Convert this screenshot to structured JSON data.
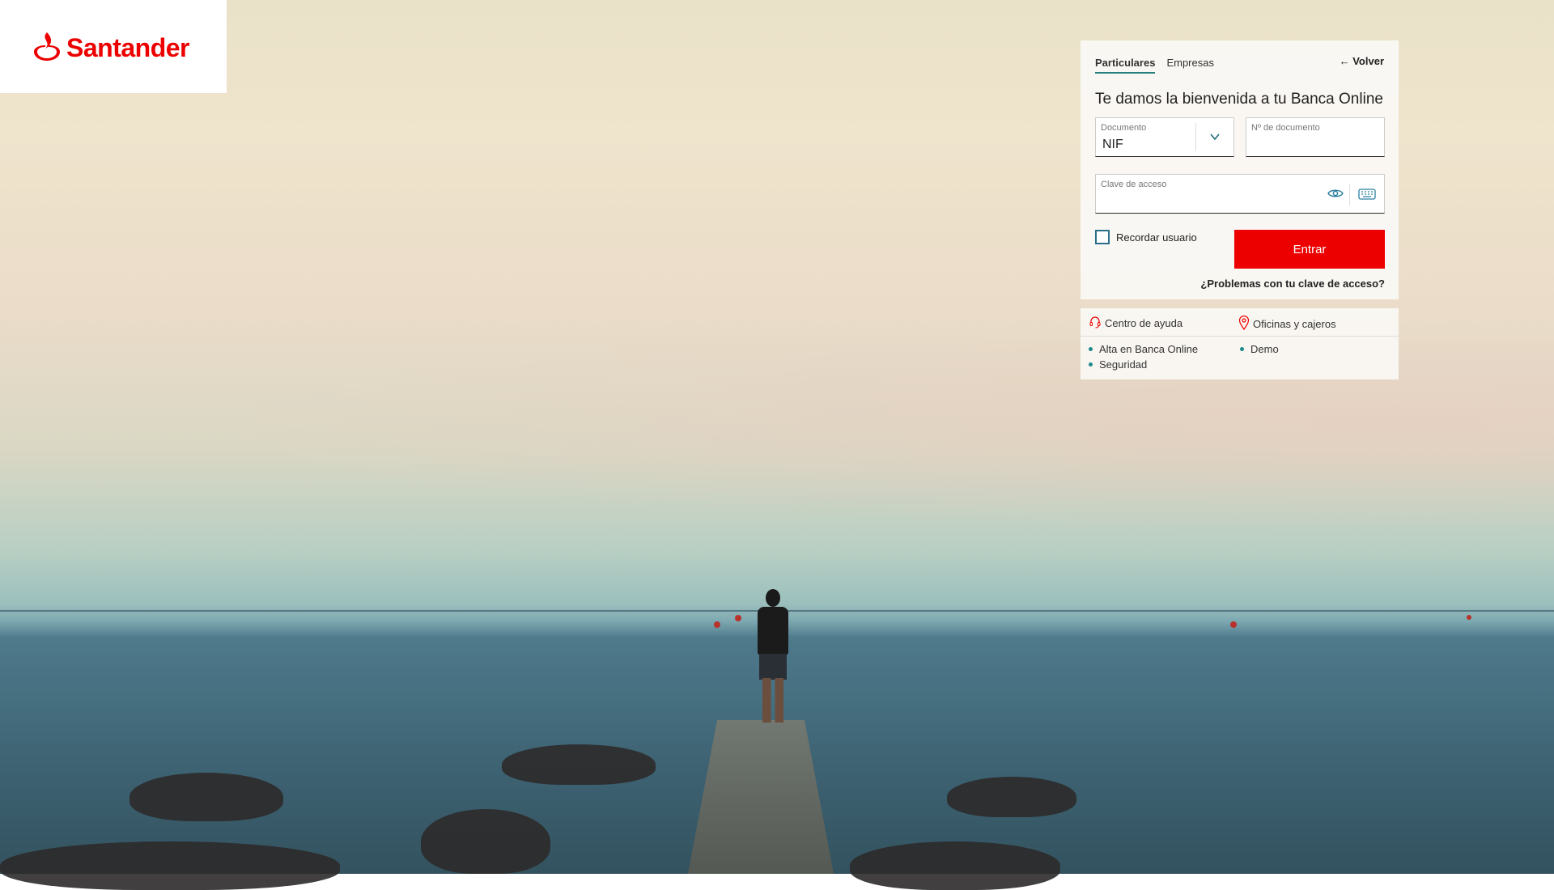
{
  "brand": {
    "name": "Santander",
    "color": "#ec0000"
  },
  "tabs": [
    {
      "label": "Particulares",
      "active": true
    },
    {
      "label": "Empresas",
      "active": false
    }
  ],
  "back_label": "Volver",
  "welcome": "Te damos la bienvenida a tu Banca Online",
  "document": {
    "label": "Documento",
    "value": "NIF"
  },
  "doc_number": {
    "label": "Nº de documento",
    "value": ""
  },
  "password": {
    "label": "Clave de acceso",
    "value": ""
  },
  "remember_label": "Recordar usuario",
  "enter_label": "Entrar",
  "problems_label": "¿Problemas con tu clave de acceso?",
  "help_links": {
    "help_center": "Centro de ayuda",
    "offices": "Oficinas y cajeros"
  },
  "bullet_links": {
    "signup": "Alta en Banca Online",
    "security": "Seguridad",
    "demo": "Demo"
  },
  "icons": {
    "logo": "santander-flame-icon",
    "back": "arrow-left-icon",
    "dropdown": "chevron-down-icon",
    "eye": "eye-icon",
    "keyboard": "keyboard-icon",
    "help": "headset-icon",
    "location": "map-pin-icon"
  }
}
